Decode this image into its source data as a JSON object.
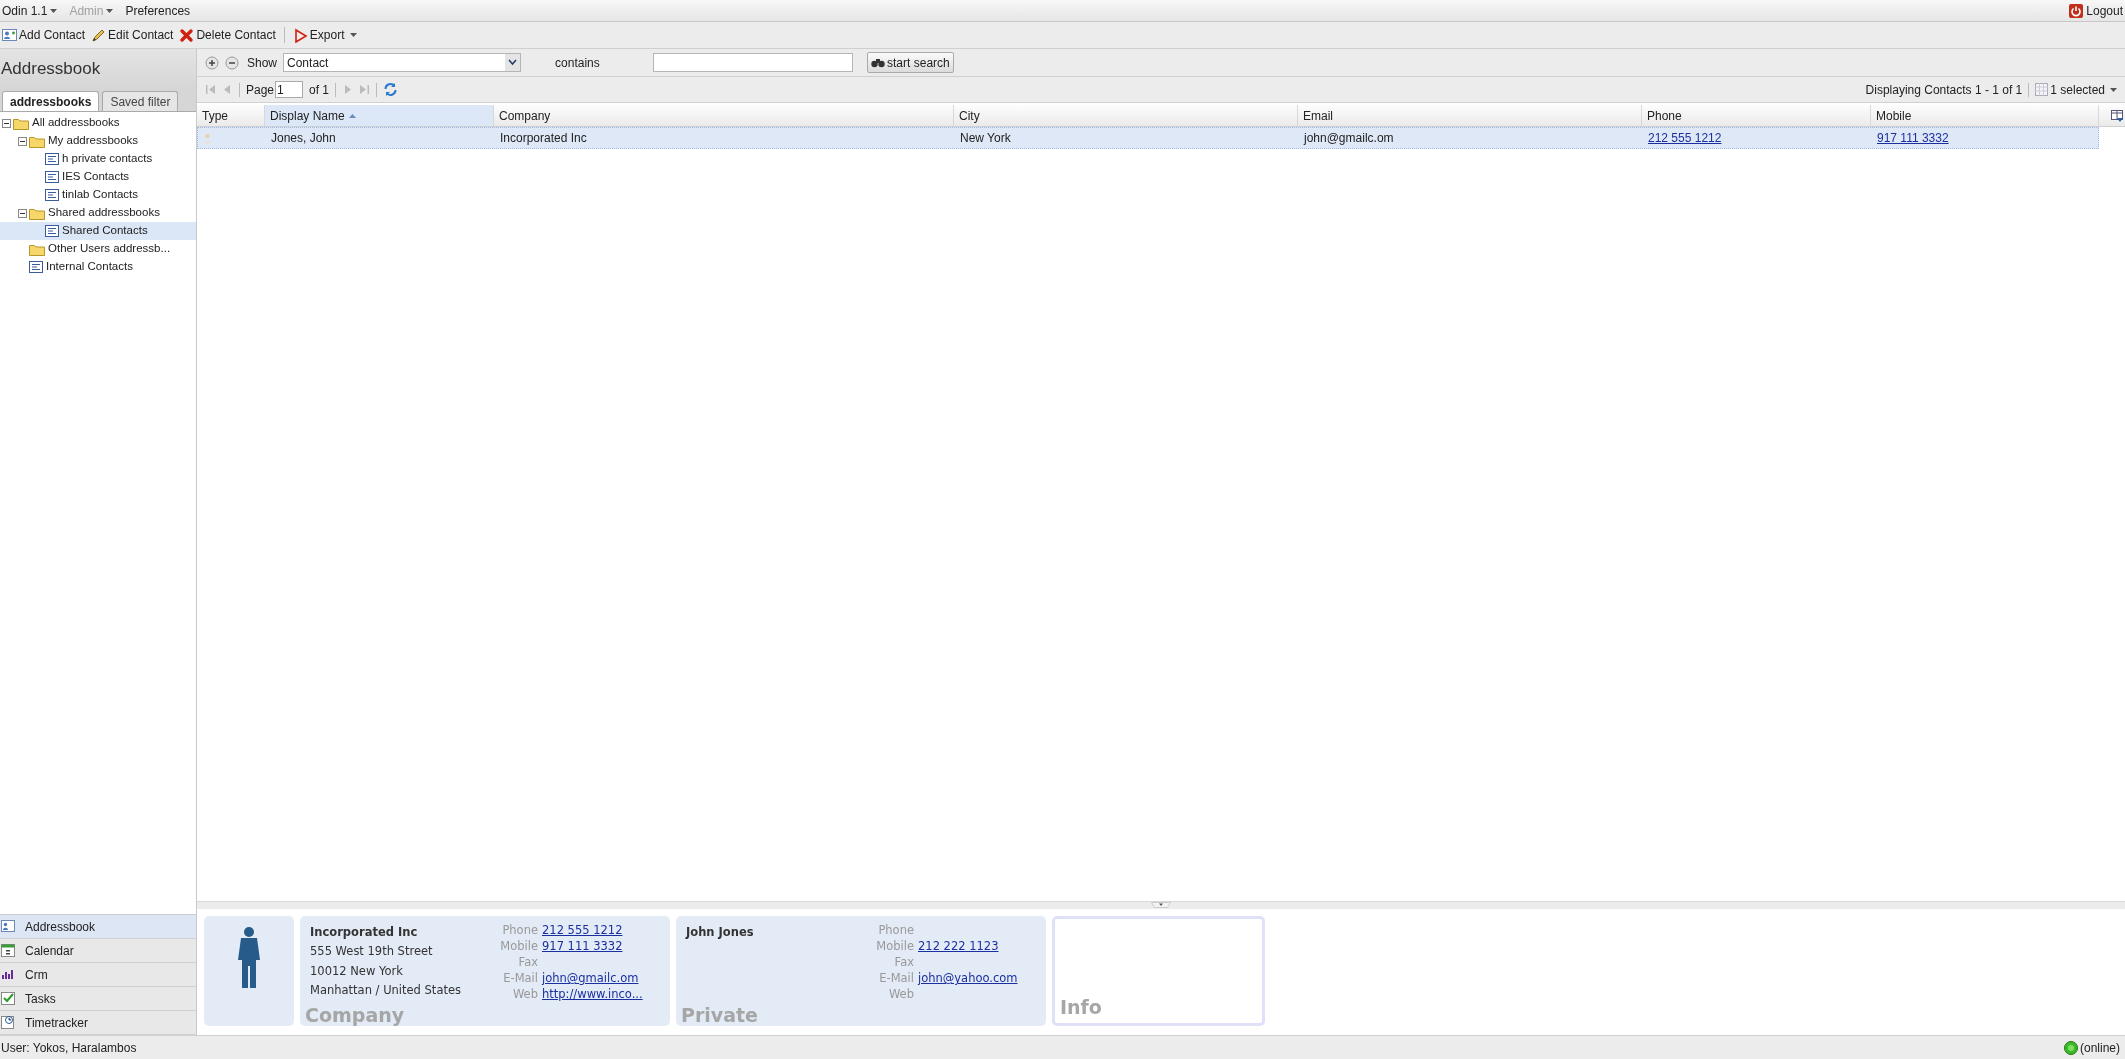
{
  "menu": [
    {
      "label": "Odin 1.1",
      "dropdown": true,
      "disabled": false
    },
    {
      "label": "Admin",
      "dropdown": true,
      "disabled": true
    },
    {
      "label": "Preferences",
      "dropdown": false,
      "disabled": false
    }
  ],
  "logout": "Logout",
  "toolbar": [
    {
      "label": "Add Contact",
      "dropdown": false
    },
    {
      "label": "Edit Contact",
      "dropdown": false
    },
    {
      "label": "Delete Contact",
      "dropdown": false
    },
    {
      "label": "Export",
      "dropdown": true
    }
  ],
  "sidebar": {
    "title": "Addressbook",
    "tabs": [
      {
        "label": "addressbooks",
        "selected": true
      },
      {
        "label": "Saved filter",
        "selected": false
      }
    ],
    "tree": [
      {
        "label": "All addressbooks",
        "kind": "folder",
        "expanded": true,
        "selected": false,
        "children": [
          {
            "label": "My addressbooks",
            "kind": "folder",
            "expanded": true,
            "selected": false,
            "children": [
              {
                "label": "h private contacts",
                "kind": "book",
                "selected": false
              },
              {
                "label": "IES Contacts",
                "kind": "book",
                "selected": false
              },
              {
                "label": "tinlab Contacts",
                "kind": "book",
                "selected": false
              }
            ]
          },
          {
            "label": "Shared addressbooks",
            "kind": "folder",
            "expanded": true,
            "selected": false,
            "children": [
              {
                "label": "Shared Contacts",
                "kind": "book",
                "selected": true
              }
            ]
          },
          {
            "label": "Other Users addressb...",
            "kind": "folder",
            "selected": false
          },
          {
            "label": "Internal Contacts",
            "kind": "book",
            "selected": false
          }
        ]
      }
    ],
    "modules": [
      {
        "label": "Addressbook",
        "selected": true
      },
      {
        "label": "Calendar",
        "selected": false
      },
      {
        "label": "Crm",
        "selected": false
      },
      {
        "label": "Tasks",
        "selected": false
      },
      {
        "label": "Timetracker",
        "selected": false
      }
    ]
  },
  "search": {
    "label": "Show",
    "field": "Contact",
    "operator": "contains",
    "button": "start search"
  },
  "paging": {
    "page_label": "Page",
    "page": "1",
    "of": "of 1",
    "display": "Displaying Contacts 1 - 1 of 1",
    "selection": "1 selected"
  },
  "table": {
    "columns": [
      {
        "label": "Type",
        "sorted": false
      },
      {
        "label": "Display Name",
        "sorted": true
      },
      {
        "label": "Company",
        "sorted": false
      },
      {
        "label": "City",
        "sorted": false
      },
      {
        "label": "Email",
        "sorted": false
      },
      {
        "label": "Phone",
        "sorted": false
      },
      {
        "label": "Mobile",
        "sorted": false
      }
    ],
    "rows": [
      {
        "selected": true,
        "cells": [
          "",
          "Jones, John",
          "Incorporated Inc",
          "New York",
          "john@gmailc.om",
          "212 555 1212",
          "917 111 3332"
        ]
      }
    ]
  },
  "details": {
    "cards": [
      {
        "caption": "Company",
        "name": "Incorporated Inc",
        "address": [
          "555 West 19th Street",
          "10012 New York",
          "Manhattan / United States"
        ],
        "fields": [
          {
            "label": "Phone",
            "value": "212 555 1212"
          },
          {
            "label": "Mobile",
            "value": "917 111 3332"
          },
          {
            "label": "Fax"
          },
          {
            "label": "E-Mail",
            "value": "john@gmailc.om"
          },
          {
            "label": "Web",
            "value": "http://www.inco..."
          }
        ]
      },
      {
        "caption": "Private",
        "name": "John Jones",
        "fields": [
          {
            "label": "Phone"
          },
          {
            "label": "Mobile",
            "value": "212 222 1123"
          },
          {
            "label": "Fax"
          },
          {
            "label": "E-Mail",
            "value": "john@yahoo.com"
          },
          {
            "label": "Web"
          }
        ]
      }
    ],
    "info_caption": "Info"
  },
  "status": {
    "user": "User: Yokos, Haralambos",
    "connection": "(online)",
    "online": true
  }
}
